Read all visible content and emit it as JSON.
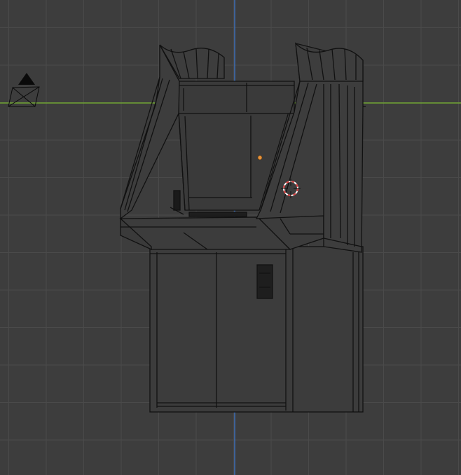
{
  "viewport": {
    "background_color": "#3d3d3d",
    "grid_color": "#4a4a4a",
    "x_axis_color": "#6fa432",
    "z_axis_color": "#3f6fb5",
    "wire_color": "#111111",
    "solid_color": "#2a2a2a",
    "origin_color": "#e8923a",
    "cursor_color_a": "#d93b3b",
    "cursor_color_b": "#ffffff"
  },
  "objects": [
    {
      "kind": "camera",
      "icon": "camera-icon"
    },
    {
      "kind": "light-origin",
      "icon": "origin-dot-icon"
    },
    {
      "kind": "mesh",
      "name": "arcade-cabinet"
    },
    {
      "kind": "3d-cursor",
      "icon": "crosshair-cursor-icon"
    }
  ]
}
